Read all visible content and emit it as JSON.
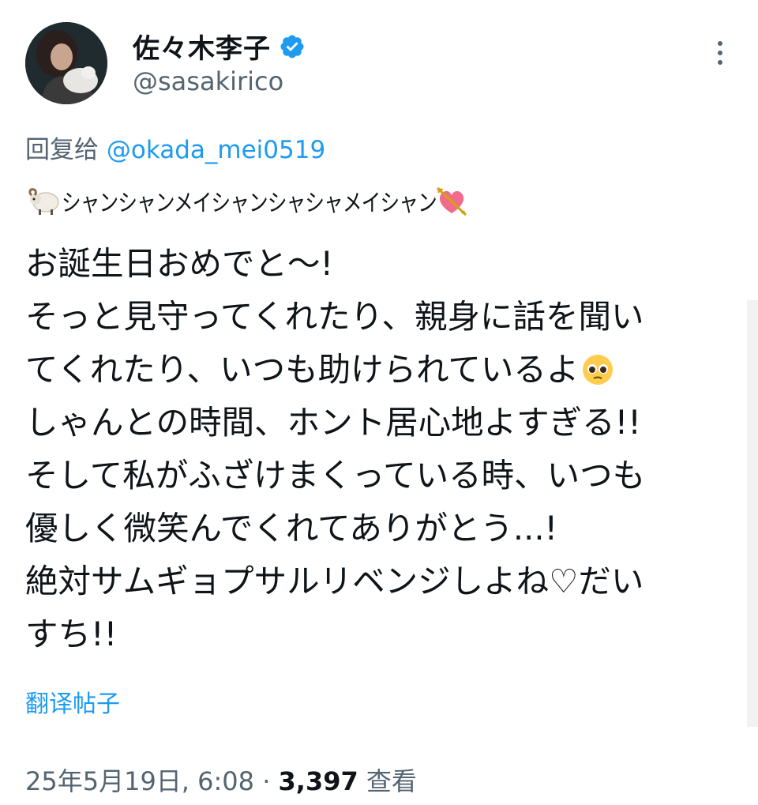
{
  "author": {
    "display_name": "佐々木李子",
    "handle": "@sasakirico",
    "avatar_icon": "avatar-photo",
    "verified_icon": "verified-badge-icon",
    "verified_color": "#1d9bf0"
  },
  "reply": {
    "prefix": "回复给",
    "mention": "@okada_mei0519"
  },
  "tweet": {
    "subline_emoji_left": "ram-emoji-icon",
    "subline_text": "シャンシャンメイシャンシャシャメイシャン",
    "subline_emoji_right": "heart-with-arrow-emoji-icon",
    "lines": [
      "お誕生日おめでと〜!",
      "そっと見守ってくれたり、親身に話を聞い",
      "てくれたり、いつも助けられているよ",
      "しゃんとの時間、ホント居心地よすぎる!!",
      "そして私がふざけまくっている時、いつも",
      "優しく微笑んでくれてありがとう...!",
      "絶対サムギョプサルリベンジしよね♡だい",
      "すち!!"
    ],
    "inline_emoji": "pleading-face-emoji-icon"
  },
  "translate_label": "翻译帖子",
  "meta": {
    "date": "25年5月19日, 6:08",
    "separator": " · ",
    "views_count": "3,397",
    "views_label": "查看"
  },
  "colors": {
    "link": "#1d9bf0",
    "secondary_text": "#536471",
    "primary_text": "#0f1419"
  }
}
